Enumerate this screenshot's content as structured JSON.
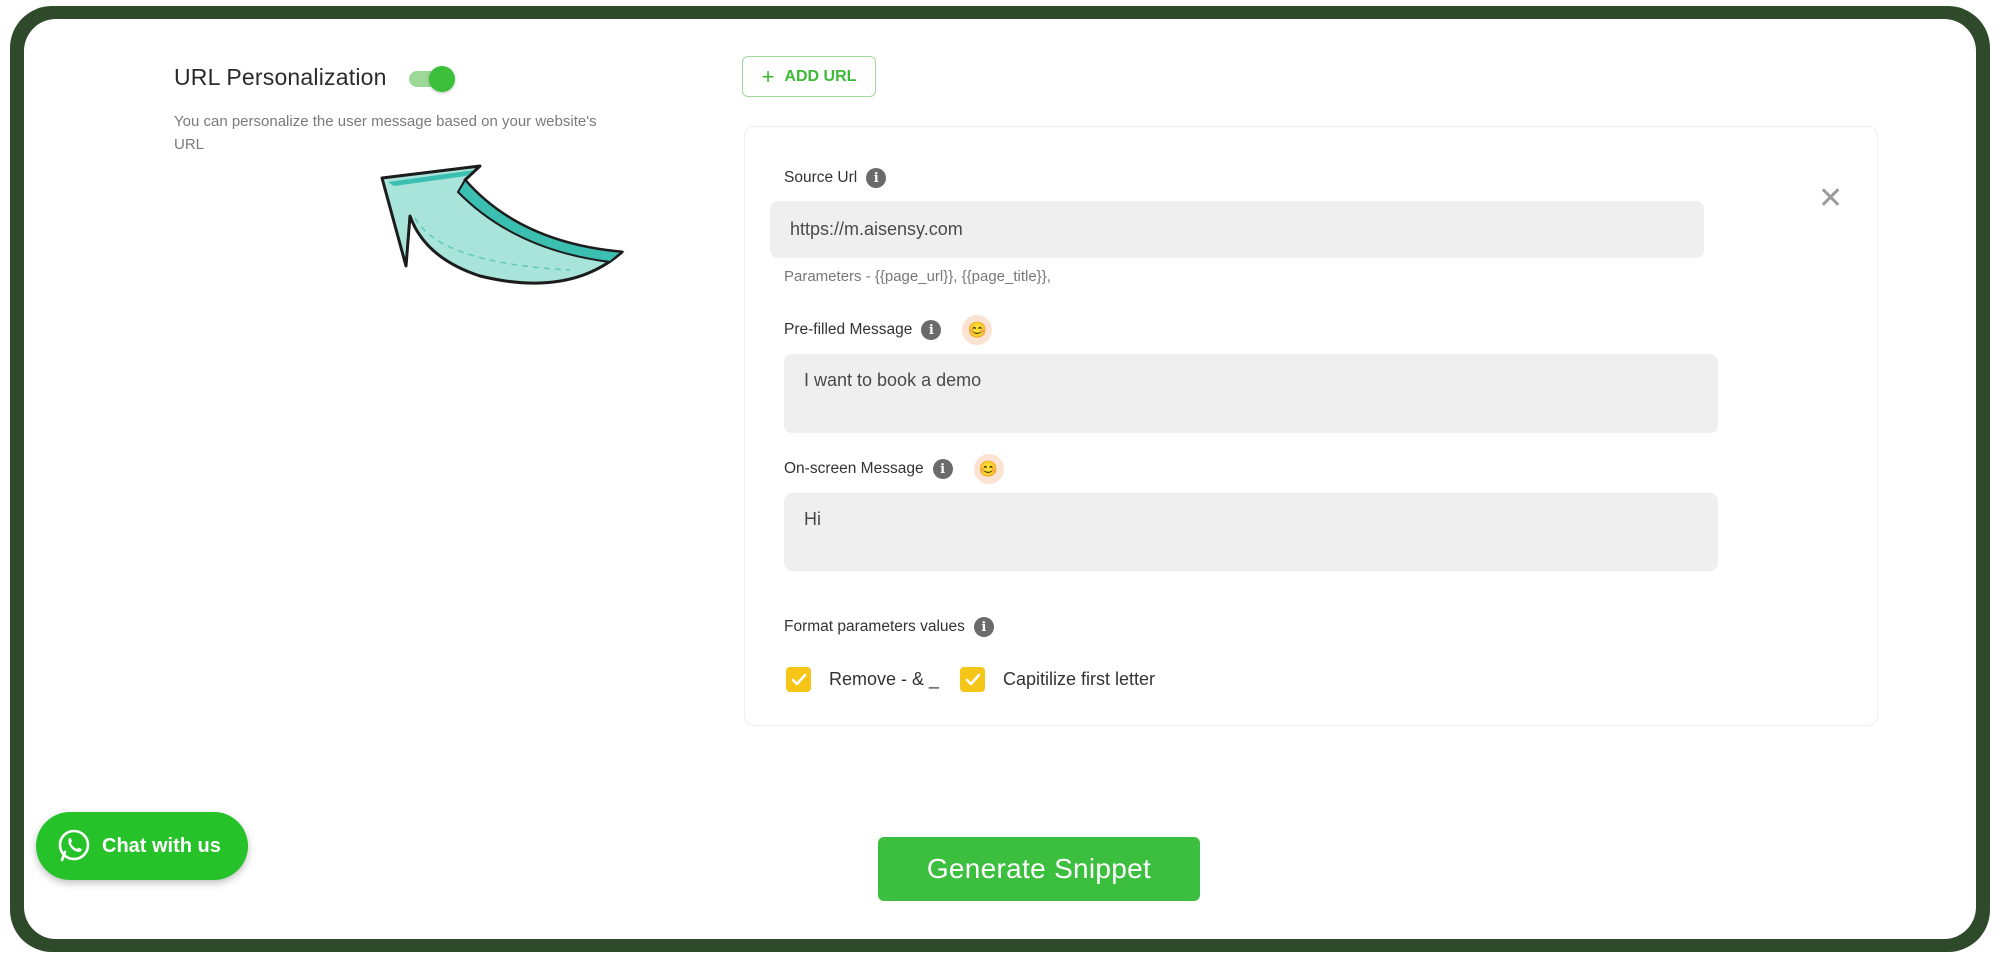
{
  "url_personalization": {
    "title": "URL Personalization",
    "toggle_state": "on",
    "description": "You can personalize the user message based on your website's URL"
  },
  "add_url": {
    "label": "ADD URL"
  },
  "form": {
    "source_url_label": "Source Url",
    "source_url_value": "https://m.aisensy.com",
    "parameters_text": "Parameters - {{page_url}}, {{page_title}},",
    "prefilled_label": "Pre-filled Message",
    "prefilled_value": "I want to book a demo",
    "onscreen_label": "On-screen Message",
    "onscreen_value": "Hi",
    "format_label": "Format parameters values",
    "checkbox_remove": "Remove - & _",
    "checkbox_capitalize": "Capitilize first letter"
  },
  "chat_button": {
    "label": "Chat with us"
  },
  "generate_button": {
    "label": "Generate Snippet"
  },
  "colors": {
    "accent_green": "#3cbf3f",
    "checkbox_yellow": "#f5c518",
    "frame_dark_green": "#2f4a2a",
    "arrow_teal": "#3bbfb0"
  }
}
